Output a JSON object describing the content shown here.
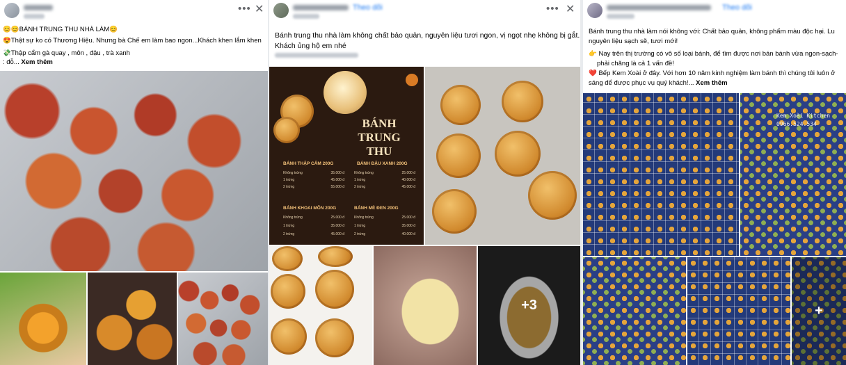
{
  "post1": {
    "text_line1": "😊😊BÁNH TRUNG THU NHÀ LÀM😊",
    "text_line2": "😍Thật sự ko có Thương Hiệu. Nhưng bà Chế em làm bao ngon...Khách khen lắm khen",
    "text_line3": "💸Thập cẩm gà quay , môn , đậu , trà xanh",
    "text_line4": ": đỗ...",
    "see_more": "Xem thêm"
  },
  "post2": {
    "text_line1": "Bánh trung thu nhà làm không chất bảo quản, nguyên liệu tươi ngon, vị ngọt nhẹ không bị gắt.",
    "text_line2": "Khách ủng hộ em nhé",
    "menu": {
      "title": "BÁNH TRUNG THU",
      "sections": [
        {
          "name": "BÁNH THẬP CẨM 200G",
          "rows": [
            [
              "Không trứng",
              "35.000 đ"
            ],
            [
              "1 trứng",
              "45.000 đ"
            ],
            [
              "2 trứng",
              "55.000 đ"
            ]
          ]
        },
        {
          "name": "BÁNH ĐẬU XANH 200G",
          "rows": [
            [
              "Không trứng",
              "25.000 đ"
            ],
            [
              "1 trứng",
              "40.000 đ"
            ],
            [
              "2 trứng",
              "45.000 đ"
            ]
          ]
        },
        {
          "name": "BÁNH KHOAI MÔN 200G",
          "rows": [
            [
              "Không trứng",
              "25.000 đ"
            ],
            [
              "1 trứng",
              "35.000 đ"
            ],
            [
              "2 trứng",
              "45.000 đ"
            ]
          ]
        },
        {
          "name": "BÁNH MÈ ĐEN 200G",
          "rows": [
            [
              "Không trứng",
              "25.000 đ"
            ],
            [
              "1 trứng",
              "35.000 đ"
            ],
            [
              "2 trứng",
              "40.000 đ"
            ]
          ]
        }
      ]
    },
    "more_photos": "+3"
  },
  "post3": {
    "text_line1": "Bánh trung thu nhà làm nói không với: Chất bảo quản, không phẩm màu độc hại. Lu",
    "text_line2": "nguyên liệu sạch sẽ, tươi mới!",
    "text_line3": "👉 Nay trên thị trường có vô số loại bánh, để tìm được nơi bán bánh vừa ngon-sạch-",
    "text_line4": "phải chăng là cả 1 vấn đề!",
    "text_line5": "❤️ Bếp Kem Xoài ở đây. Với hơn 10 năm kinh nghiệm làm bánh thì chúng tôi luôn ở",
    "text_line6": "sáng để được phục vụ quý khách!...",
    "see_more": "Xem thêm",
    "watermark_line1": "Kem Xoài Kitchen",
    "watermark_line2": "0966.524.534",
    "more_photos": "+"
  },
  "icons": {
    "more": "more-horizontal-icon",
    "close": "close-icon"
  }
}
